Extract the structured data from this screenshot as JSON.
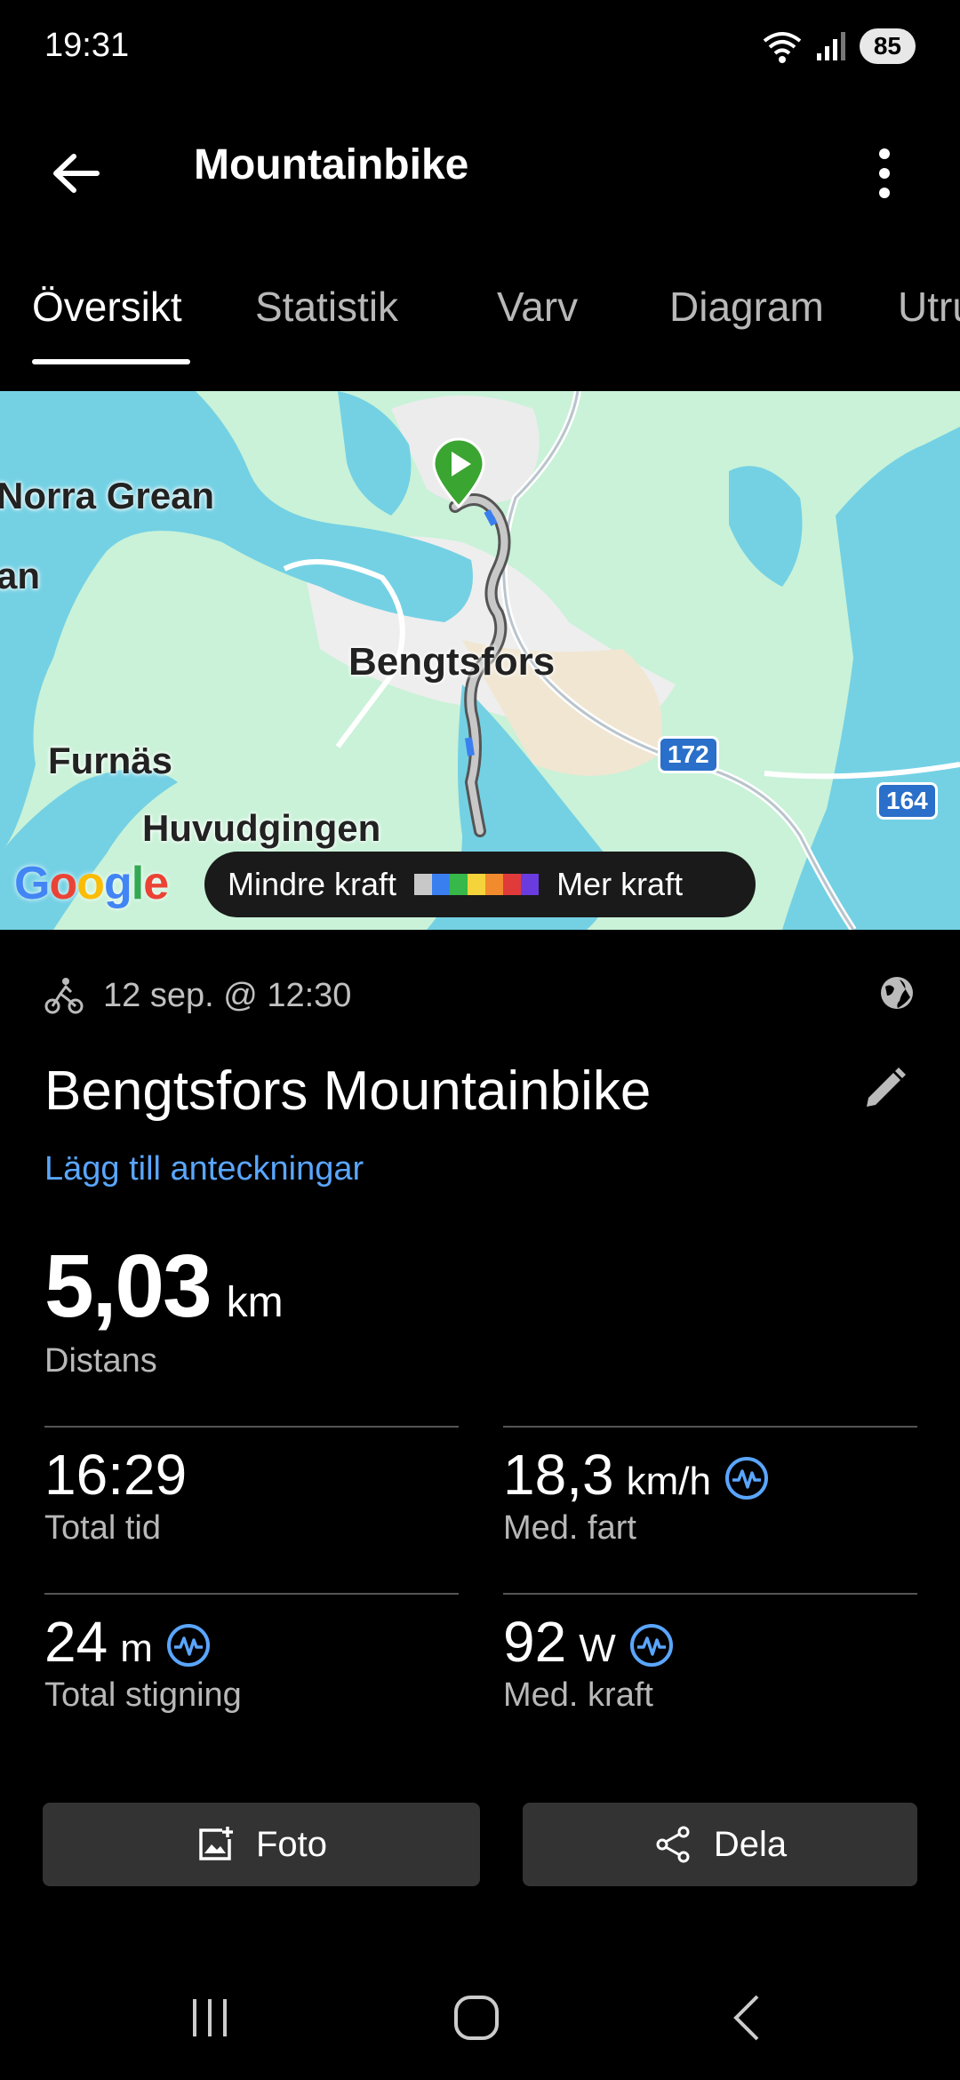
{
  "status_bar": {
    "time": "19:31",
    "battery": "85",
    "wifi_icon": "wifi-icon",
    "signal_icon": "signal-icon"
  },
  "header": {
    "title": "Mountainbike",
    "back_icon": "arrow-left-icon",
    "menu_icon": "more-vert-icon"
  },
  "tabs": [
    {
      "label": "Översikt",
      "active": true
    },
    {
      "label": "Statistik",
      "active": false
    },
    {
      "label": "Varv",
      "active": false
    },
    {
      "label": "Diagram",
      "active": false
    },
    {
      "label": "Utrustning",
      "active": false
    }
  ],
  "map": {
    "places": [
      "Norra Grean",
      "an",
      "Bengtsfors",
      "Furnäs",
      "Huvudgingen"
    ],
    "roads": [
      "172",
      "164"
    ],
    "google_logo": "Google",
    "legend": {
      "left_label": "Mindre kraft",
      "right_label": "Mer kraft",
      "colors": [
        "#c8c8c8",
        "#3a7ff0",
        "#37b84a",
        "#f5d33a",
        "#f28a2e",
        "#e03a3a",
        "#6a3ce0"
      ]
    },
    "start_marker": "start-marker-icon"
  },
  "activity": {
    "type_icon": "bike-icon",
    "date": "12 sep. @ 12:30",
    "privacy_icon": "globe-icon",
    "name": "Bengtsfors Mountainbike",
    "add_notes": "Lägg till anteckningar",
    "distance": {
      "value": "5,03",
      "unit": "km",
      "label": "Distans"
    }
  },
  "stats": [
    {
      "value": "16:29",
      "unit": "",
      "label": "Total tid",
      "has_chart": false
    },
    {
      "value": "18,3",
      "unit": "km/h",
      "label": "Med. fart",
      "has_chart": true
    },
    {
      "value": "24",
      "unit": "m",
      "label": "Total stigning",
      "has_chart": true
    },
    {
      "value": "92",
      "unit": "W",
      "label": "Med. kraft",
      "has_chart": true
    }
  ],
  "actions": {
    "photo_label": "Foto",
    "share_label": "Dela"
  },
  "colors": {
    "accent": "#5aa6ff",
    "button_bg": "#333333",
    "background": "#000000"
  }
}
